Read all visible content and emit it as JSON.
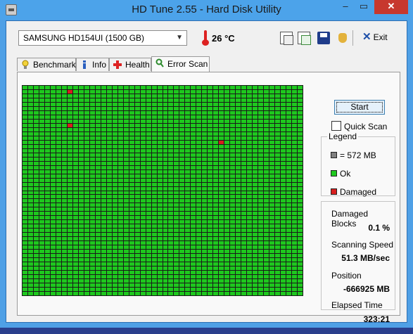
{
  "window": {
    "title": "HD Tune 2.55 - Hard Disk Utility",
    "min_glyph": "–",
    "max_glyph": "▭",
    "close_glyph": "✕"
  },
  "toolbar": {
    "drive": "SAMSUNG HD154UI (1500 GB)",
    "temperature": "26 °C",
    "exit_label": "Exit",
    "icons": [
      "copy-text-icon",
      "copy-screenshot-icon",
      "save-icon",
      "options-hand-icon",
      "exit-icon"
    ]
  },
  "tabs": [
    {
      "label": "Benchmark",
      "icon": "benchmark-icon"
    },
    {
      "label": "Info",
      "icon": "info-icon"
    },
    {
      "label": "Health",
      "icon": "health-cross-icon"
    },
    {
      "label": "Error Scan",
      "icon": "magnifier-icon",
      "active": true
    }
  ],
  "scan": {
    "start_label": "Start",
    "quick_scan_label": "Quick Scan",
    "quick_scan_checked": false,
    "grid": {
      "columns": 50,
      "rows": 50,
      "damaged": [
        [
          35,
          13
        ],
        [
          8,
          1
        ],
        [
          8,
          9
        ]
      ]
    }
  },
  "legend": {
    "title": "Legend",
    "block_size": "= 572 MB",
    "ok": "Ok",
    "damaged": "Damaged",
    "colors": {
      "block": "#808080",
      "ok": "#1ec81e",
      "damaged": "#d81e1e"
    }
  },
  "stats": {
    "damaged_blocks_label": "Damaged Blocks",
    "damaged_blocks_value": "0.1 %",
    "scanning_speed_label": "Scanning Speed",
    "scanning_speed_value": "51.3 MB/sec",
    "position_label": "Position",
    "position_value": "-666925 MB",
    "elapsed_label": "Elapsed Time",
    "elapsed_value": "323:21"
  }
}
